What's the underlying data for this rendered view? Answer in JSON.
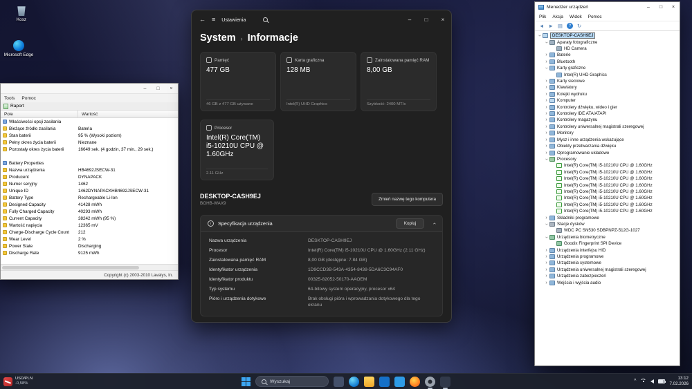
{
  "icons": {
    "chevron": "›",
    "minimize": "–",
    "maximize": "□",
    "close": "×",
    "back": "←",
    "menu": "≡",
    "info": "i",
    "tray_chevron": "^"
  },
  "desktop": {
    "icons": [
      {
        "name": "recycle-bin",
        "label": "Kosz"
      },
      {
        "name": "microsoft-edge",
        "label": "Microsoft Edge"
      }
    ]
  },
  "settings": {
    "titlebar": {
      "app": "Ustawienia"
    },
    "breadcrumb": {
      "section": "System",
      "separator": "›",
      "page": "Informacje"
    },
    "cards": [
      {
        "title": "Pamięć",
        "value": "477 GB",
        "footer": "46 GB z 477 GB używane"
      },
      {
        "title": "Karta graficzna",
        "value": "128 MB",
        "footer": "Intel(R) UHD Graphics"
      },
      {
        "title": "Zainstalowana pamięć RAM",
        "value": "8,00 GB",
        "footer": "Szybkość: 2400 MT/s"
      },
      {
        "title": "Procesor",
        "value": "Intel(R) Core(TM) i5-10210U CPU @ 1.60GHz",
        "footer": "2.11 GHz"
      }
    ],
    "rename": {
      "device_name": "DESKTOP-CASH9EJ",
      "device_model": "BOHB-WAX9",
      "button": "Zmień nazwę tego komputera"
    },
    "spec": {
      "title": "Specyfikacja urządzenia",
      "copy_button": "Kopiuj",
      "rows": [
        {
          "label": "Nazwa urządzenia",
          "value": "DESKTOP-CASH9EJ"
        },
        {
          "label": "Procesor",
          "value": "Intel(R) Core(TM) i5-10210U CPU @ 1.60GHz (2.11 GHz)"
        },
        {
          "label": "Zainstalowana pamięć RAM",
          "value": "8,00 GB (dostępne: 7.84 GB)"
        },
        {
          "label": "Identyfikator urządzenia",
          "value": "1D9CCD3B-543A-4354-8438-5DA6C3C94AF0"
        },
        {
          "label": "Identyfikator produktu",
          "value": "00325-82052-50170-AAOEM"
        },
        {
          "label": "Typ systemu",
          "value": "64-bitowy system operacyjny, procesor x64"
        },
        {
          "label": "Pióro i urządzenia dotykowe",
          "value": "Brak obsługi pióra i wprowadzania dotykowego dla tego ekranu"
        }
      ]
    }
  },
  "battery_report": {
    "menus": [
      "Tools",
      "Pomoc"
    ],
    "tab": "Raport",
    "columns": [
      "Pole",
      "Wartość"
    ],
    "rows": [
      {
        "group": true,
        "label": "Właściwości opcji zasilania"
      },
      {
        "label": "Bieżące źródło zasilania",
        "value": "Bateria"
      },
      {
        "label": "Stan baterii",
        "value": "95 % (Wysoki poziom)"
      },
      {
        "label": "Pełny okres życia baterii",
        "value": "Nieznane"
      },
      {
        "label": "Pozostały okres życia baterii",
        "value": "16649 sek. (4 godzin, 37 min., 29 sek.)"
      },
      {
        "spacer": true
      },
      {
        "group": true,
        "label": "Battery Properties"
      },
      {
        "label": "Nazwa urządzenia",
        "value": "HB4692JSECW-31"
      },
      {
        "label": "Producent",
        "value": "DYNAPACK"
      },
      {
        "label": "Numer seryjny",
        "value": "1462"
      },
      {
        "label": "Unique ID",
        "value": "1462DYNAPACKHB4692JSECW-31"
      },
      {
        "label": "Battery Type",
        "value": "Rechargeable Li-Ion"
      },
      {
        "label": "Designed Capacity",
        "value": "41428 mWh"
      },
      {
        "label": "Fully Charged Capacity",
        "value": "40293 mWh"
      },
      {
        "label": "Current Capacity",
        "value": "38242 mWh  (95 %)"
      },
      {
        "label": "Wartość napięcia",
        "value": "12365 mV"
      },
      {
        "label": "Charge-Discharge Cycle Count",
        "value": "212"
      },
      {
        "label": "Wear Level",
        "value": "2 %"
      },
      {
        "label": "Power State",
        "value": "Discharging"
      },
      {
        "label": "Discharge Rate",
        "value": "9125 mWh"
      }
    ],
    "statusbar": "Copyright (c) 2003-2010 Lavalys, In."
  },
  "device_manager": {
    "title": "Menedżer urządzeń",
    "menus": [
      "Plik",
      "Akcja",
      "Widok",
      "Pomoc"
    ],
    "toolbar": [
      {
        "name": "back-icon",
        "glyph": "◄"
      },
      {
        "name": "forward-icon",
        "glyph": "►"
      },
      {
        "name": "list-icon",
        "glyph": "▤"
      },
      {
        "name": "help-icon",
        "glyph": "?"
      },
      {
        "name": "refresh-icon",
        "glyph": "↻"
      }
    ],
    "tree": [
      {
        "level": 0,
        "state": "expanded",
        "icon": "computer",
        "label": "DESKTOP-CASH9EJ",
        "editing": true
      },
      {
        "level": 1,
        "state": "expanded",
        "icon": "camera",
        "label": "Aparaty fotograficzne"
      },
      {
        "level": 2,
        "state": "leaf",
        "icon": "camera",
        "label": "HD Camera"
      },
      {
        "level": 1,
        "state": "collapsed",
        "icon": "battery",
        "label": "Baterie"
      },
      {
        "level": 1,
        "state": "collapsed",
        "icon": "bluetooth",
        "label": "Bluetooth"
      },
      {
        "level": 1,
        "state": "expanded",
        "icon": "display",
        "label": "Karty graficzne"
      },
      {
        "level": 2,
        "state": "leaf",
        "icon": "display",
        "label": "Intel(R) UHD Graphics"
      },
      {
        "level": 1,
        "state": "collapsed",
        "icon": "network",
        "label": "Karty sieciowe"
      },
      {
        "level": 1,
        "state": "collapsed",
        "icon": "keyboard",
        "label": "Klawiatury"
      },
      {
        "level": 1,
        "state": "collapsed",
        "icon": "printer",
        "label": "Kolejki wydruku"
      },
      {
        "level": 1,
        "state": "collapsed",
        "icon": "computer",
        "label": "Komputer"
      },
      {
        "level": 1,
        "state": "collapsed",
        "icon": "sound",
        "label": "Kontrolery dźwięku, wideo i gier"
      },
      {
        "level": 1,
        "state": "collapsed",
        "icon": "ide",
        "label": "Kontrolery IDE ATA/ATAPI"
      },
      {
        "level": 1,
        "state": "collapsed",
        "icon": "storage",
        "label": "Kontrolery magazynu"
      },
      {
        "level": 1,
        "state": "collapsed",
        "icon": "usb",
        "label": "Kontrolery uniwersalnej magistrali szeregowej"
      },
      {
        "level": 1,
        "state": "collapsed",
        "icon": "monitor",
        "label": "Monitory"
      },
      {
        "level": 1,
        "state": "collapsed",
        "icon": "mouse",
        "label": "Mysz i inne urządzenia wskazujące"
      },
      {
        "level": 1,
        "state": "collapsed",
        "icon": "audio-endpoint",
        "label": "Obiekty przetwarzania dźwięku"
      },
      {
        "level": 1,
        "state": "collapsed",
        "icon": "firmware",
        "label": "Oprogramowanie układowe"
      },
      {
        "level": 1,
        "state": "expanded",
        "icon": "cpu",
        "label": "Procesory"
      },
      {
        "level": 2,
        "state": "leaf",
        "icon": "cpu-green",
        "label": "Intel(R) Core(TM) i5-10210U CPU @ 1.60GHz"
      },
      {
        "level": 2,
        "state": "leaf",
        "icon": "cpu-green",
        "label": "Intel(R) Core(TM) i5-10210U CPU @ 1.60GHz"
      },
      {
        "level": 2,
        "state": "leaf",
        "icon": "cpu-green",
        "label": "Intel(R) Core(TM) i5-10210U CPU @ 1.60GHz"
      },
      {
        "level": 2,
        "state": "leaf",
        "icon": "cpu-green",
        "label": "Intel(R) Core(TM) i5-10210U CPU @ 1.60GHz"
      },
      {
        "level": 2,
        "state": "leaf",
        "icon": "cpu-green",
        "label": "Intel(R) Core(TM) i5-10210U CPU @ 1.60GHz"
      },
      {
        "level": 2,
        "state": "leaf",
        "icon": "cpu-green",
        "label": "Intel(R) Core(TM) i5-10210U CPU @ 1.60GHz"
      },
      {
        "level": 2,
        "state": "leaf",
        "icon": "cpu-green",
        "label": "Intel(R) Core(TM) i5-10210U CPU @ 1.60GHz"
      },
      {
        "level": 2,
        "state": "leaf",
        "icon": "cpu-green",
        "label": "Intel(R) Core(TM) i5-10210U CPU @ 1.60GHz"
      },
      {
        "level": 1,
        "state": "collapsed",
        "icon": "software",
        "label": "Składniki programowe"
      },
      {
        "level": 1,
        "state": "expanded",
        "icon": "disk",
        "label": "Stacje dysków"
      },
      {
        "level": 2,
        "state": "leaf",
        "icon": "disk",
        "label": "WDC PC SN530 SDBPNPZ-512G-1027"
      },
      {
        "level": 1,
        "state": "expanded",
        "icon": "biometric",
        "label": "Urządzenia biometryczne"
      },
      {
        "level": 2,
        "state": "leaf",
        "icon": "biometric",
        "label": "Goodix Fingerprint SPI Device"
      },
      {
        "level": 1,
        "state": "collapsed",
        "icon": "hid",
        "label": "Urządzenia interfejsu HID"
      },
      {
        "level": 1,
        "state": "collapsed",
        "icon": "software",
        "label": "Urządzenia programowe"
      },
      {
        "level": 1,
        "state": "collapsed",
        "icon": "system",
        "label": "Urządzenia systemowe"
      },
      {
        "level": 1,
        "state": "collapsed",
        "icon": "usb",
        "label": "Urządzenia uniwersalnej magistrali szeregowej"
      },
      {
        "level": 1,
        "state": "collapsed",
        "icon": "security",
        "label": "Urządzenia zabezpieczeń"
      },
      {
        "level": 1,
        "state": "collapsed",
        "icon": "audio",
        "label": "Wejścia i wyjścia audio"
      }
    ]
  },
  "taskbar": {
    "widget": {
      "pair": "USD/PLN",
      "change": "-0,58%"
    },
    "search_placeholder": "Wyszukaj",
    "apps": [
      {
        "name": "task-view-icon",
        "shape": "square",
        "color": "#44506a"
      },
      {
        "name": "edge-icon",
        "shape": "circle",
        "color": "radial-gradient(circle at 35% 30%, #6fd8f7, #1279d0 70%)"
      },
      {
        "name": "file-explorer-icon",
        "shape": "folder",
        "color": "linear-gradient(#ffd45e, #f0a82c)"
      },
      {
        "name": "store-icon",
        "shape": "square",
        "color": "#1570c8"
      },
      {
        "name": "mail-icon",
        "shape": "square",
        "color": "#2e9be6"
      },
      {
        "name": "firefox-icon",
        "shape": "circle",
        "color": "radial-gradient(circle at 40% 35%, #ffd24d, #ff7a1f 65%)"
      },
      {
        "name": "settings-gear-icon",
        "shape": "circle",
        "color": "radial-gradient(circle, #262a33 26%, #9aa2ad 30%, #9aa2ad 70%, #262a33 74%)",
        "active": true
      },
      {
        "name": "terminal-icon",
        "shape": "square",
        "color": "#31394a",
        "active": true
      }
    ],
    "tray": {
      "time": "13:12",
      "date": "7.02.2026"
    }
  }
}
